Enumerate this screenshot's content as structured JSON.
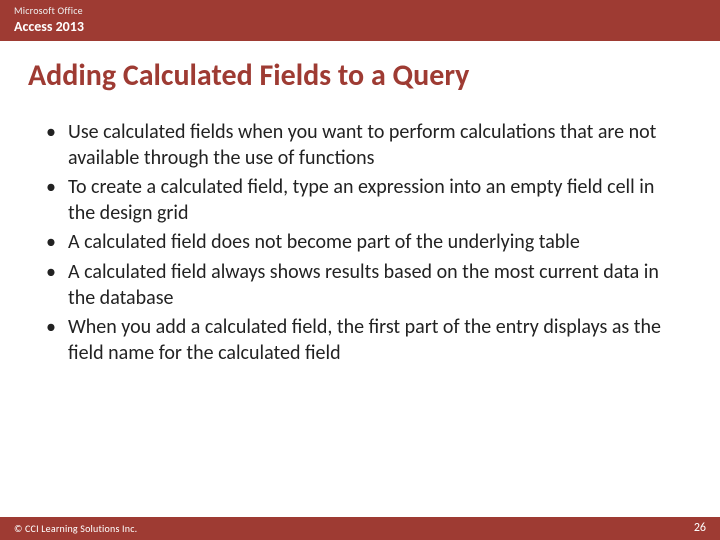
{
  "header": {
    "brand": "Microsoft Office",
    "product": "Access 2013"
  },
  "title": "Adding Calculated Fields to a Query",
  "bullets": [
    "Use calculated fields when you want to perform calculations that are not available through the use of functions",
    "To create a calculated field, type an expression into an empty field cell in the design grid",
    "A calculated field does not become part of the underlying table",
    "A calculated field always shows results based on the most current data in the database",
    "When you add a calculated field, the first part of the entry displays as the field name for the calculated field"
  ],
  "footer": {
    "copyright": "© CCI Learning Solutions Inc.",
    "page": "26"
  }
}
